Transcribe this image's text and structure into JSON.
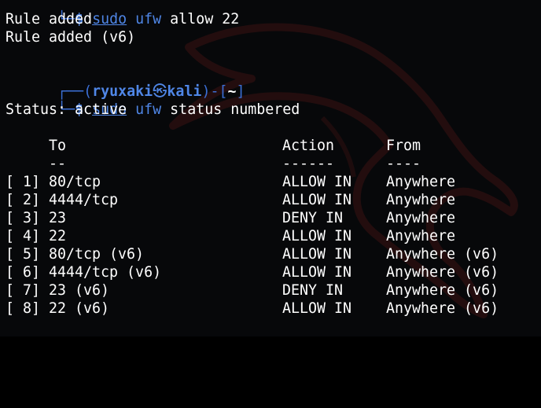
{
  "prompt1": {
    "dollar": "$",
    "sudo": "sudo",
    "prog": "ufw",
    "args": " allow 22"
  },
  "output1": [
    "Rule added",
    "Rule added (v6)"
  ],
  "prompt2": {
    "open": "┌──(",
    "user": "ryuxaki",
    "skull": "㉿",
    "host": "kali",
    "mid": ")-[",
    "path": "~",
    "close": "]",
    "dollar": "$",
    "sudo": "sudo",
    "prog": "ufw",
    "args": " status numbered"
  },
  "status_line": "Status: active",
  "table": {
    "headers": {
      "to": "To",
      "action": "Action",
      "from": "From"
    },
    "underlines": {
      "to": "--",
      "action": "------",
      "from": "----"
    },
    "rows": [
      {
        "num": "[ 1]",
        "to": "80/tcp",
        "action": "ALLOW IN",
        "from": "Anywhere"
      },
      {
        "num": "[ 2]",
        "to": "4444/tcp",
        "action": "ALLOW IN",
        "from": "Anywhere"
      },
      {
        "num": "[ 3]",
        "to": "23",
        "action": "DENY IN",
        "from": "Anywhere"
      },
      {
        "num": "[ 4]",
        "to": "22",
        "action": "ALLOW IN",
        "from": "Anywhere"
      },
      {
        "num": "[ 5]",
        "to": "80/tcp (v6)",
        "action": "ALLOW IN",
        "from": "Anywhere (v6)"
      },
      {
        "num": "[ 6]",
        "to": "4444/tcp (v6)",
        "action": "ALLOW IN",
        "from": "Anywhere (v6)"
      },
      {
        "num": "[ 7]",
        "to": "23 (v6)",
        "action": "DENY IN",
        "from": "Anywhere (v6)"
      },
      {
        "num": "[ 8]",
        "to": "22 (v6)",
        "action": "ALLOW IN",
        "from": "Anywhere (v6)"
      }
    ]
  },
  "colors": {
    "background": "#07080a",
    "prompt_blue": "#4f86e6",
    "text": "#ffffff",
    "watermark": "#2a0d0d"
  },
  "icons": {
    "watermark": "kali-dragon-watermark-icon"
  }
}
